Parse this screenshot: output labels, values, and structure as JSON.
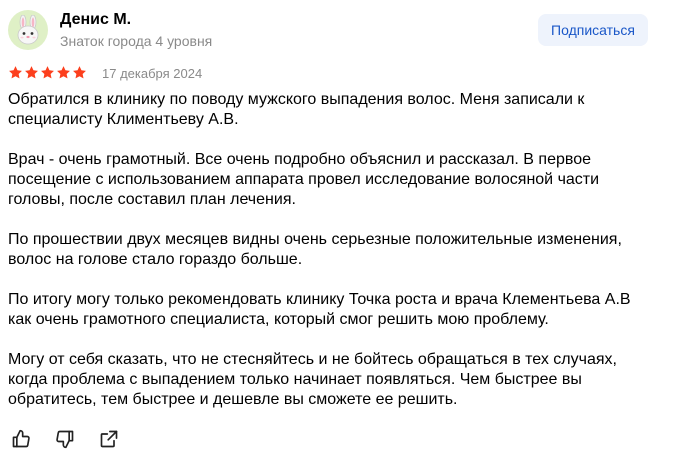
{
  "author": {
    "name": "Денис М.",
    "level": "Знаток города 4 уровня",
    "avatar_icon": "bunny-avatar-icon"
  },
  "subscribe_label": "Подписаться",
  "rating": {
    "stars": 5,
    "max": 5,
    "color": "#fc3f1d"
  },
  "date": "17 декабря 2024",
  "paragraphs": [
    "Обратился в клинику по поводу мужского выпадения волос. Меня записали к специалисту Климентьеву А.В.",
    "Врач - очень грамотный. Все очень подробно объяснил и рассказал. В первое посещение с использованием аппарата провел исследование волосяной части головы, после составил план лечения.",
    "По прошествии двух месяцев видны очень серьезные положительные изменения, волос на голове стало гораздо больше.",
    "По итогу могу только рекомендовать клинику Точка роста и врача Клементьева А.В как очень грамотного специалиста, который смог решить мою проблему.",
    "Могу от себя сказать, что не стесняйтесь и не бойтесь обращаться в тех случаях, когда проблема с выпадением только начинает появляться. Чем быстрее вы обратитесь, тем быстрее и дешевле вы сможете ее решить."
  ],
  "actions": [
    "thumbs-up-icon",
    "thumbs-down-icon",
    "share-icon"
  ],
  "colors": {
    "accent": "#1a57c8",
    "button_bg": "#eef3fc",
    "star": "#fc3f1d",
    "muted": "#8a8a8a"
  }
}
